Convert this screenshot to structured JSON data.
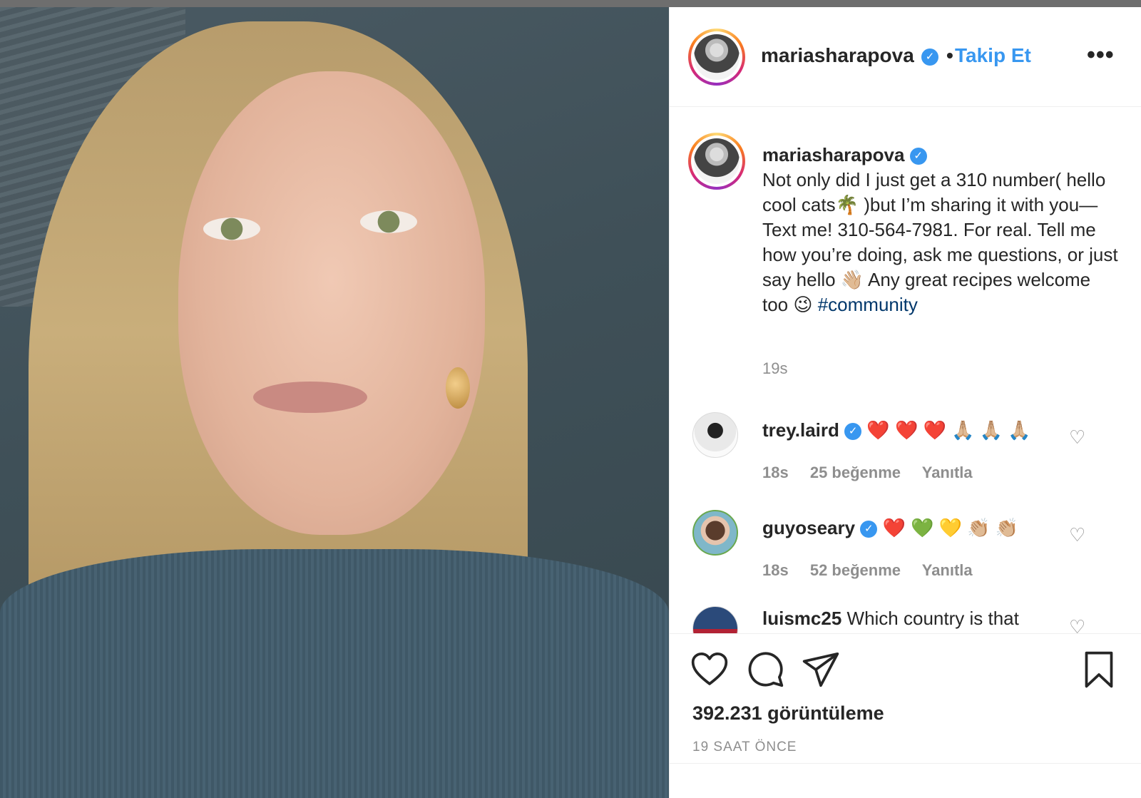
{
  "post": {
    "username": "mariasharapova",
    "follow_label": "Takip Et",
    "dot": "•",
    "more_label": "•••"
  },
  "caption": {
    "username": "mariasharapova",
    "text": "Not only did I just get a 310 number( hello cool cats🌴 )but I’m sharing it with you—Text me! 310-564-7981. For real. Tell me how you’re doing, ask me questions, or just say hello 👋🏼 Any great recipes welcome too 😉",
    "hashtag": "#community",
    "time": "19s"
  },
  "comments": [
    {
      "username": "trey.laird",
      "verified": true,
      "text": "❤️ ❤️ ❤️ 🙏🏼 🙏🏼 🙏🏼",
      "time": "18s",
      "likes": "25 beğenme",
      "reply": "Yanıtla"
    },
    {
      "username": "guyoseary",
      "verified": true,
      "text": "❤️ 💚 💛 👏🏼 👏🏼",
      "time": "18s",
      "likes": "52 beğenme",
      "reply": "Yanıtla"
    },
    {
      "username": "luismc25",
      "verified": false,
      "text": "Which country is that"
    }
  ],
  "footer": {
    "views": "392.231 görüntüleme",
    "time_ago": "19 SAAT ÖNCE"
  },
  "icons": {
    "verified": "verified-badge-icon",
    "like": "heart-icon",
    "comment": "comment-bubble-icon",
    "share": "paper-plane-icon",
    "save": "bookmark-icon"
  },
  "colors": {
    "accent": "#3897f0",
    "hashtag": "#00376b",
    "muted": "#8e8e8e",
    "text": "#262626"
  }
}
